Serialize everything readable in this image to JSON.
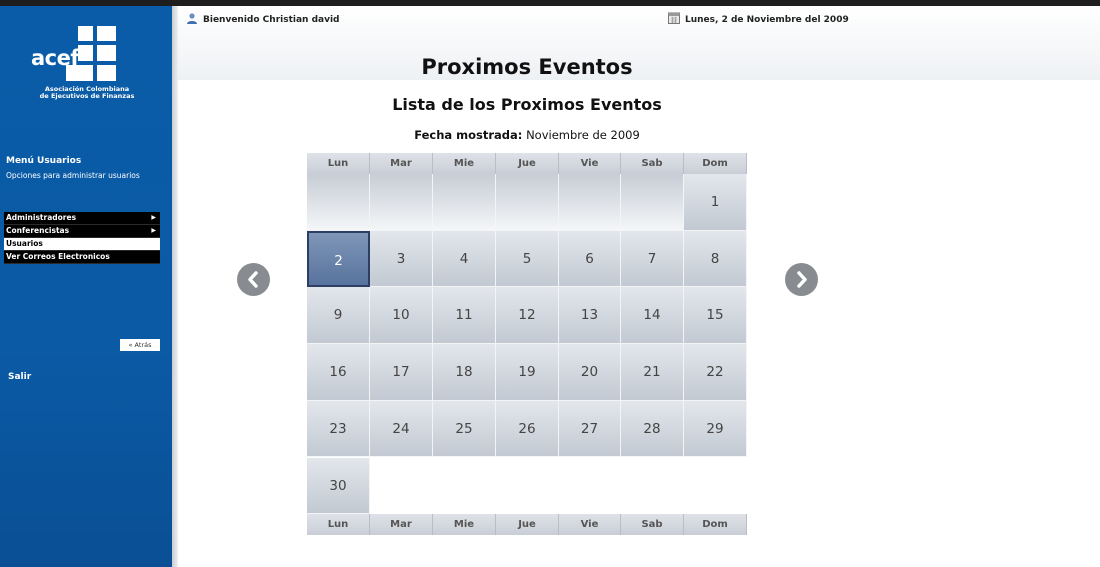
{
  "brand": {
    "logo_text": "acef",
    "subtitle_line1": "Asociación Colombiana",
    "subtitle_line2": "de Ejecutivos de Finanzas"
  },
  "header": {
    "welcome": "Bienvenido Christian david",
    "date": "Lunes, 2 de Noviembre del 2009",
    "user_icon": "user-icon",
    "calendar_icon": "calendar-icon"
  },
  "sidebar": {
    "menu_title": "Menú Usuarios",
    "menu_desc": "Opciones para administrar usuarios",
    "items": [
      {
        "label": "Administradores",
        "has_submenu": true,
        "active": false
      },
      {
        "label": "Conferencistas",
        "has_submenu": true,
        "active": false
      },
      {
        "label": "Usuarios",
        "has_submenu": false,
        "active": true
      },
      {
        "label": "Ver Correos Electronicos",
        "has_submenu": false,
        "active": false
      }
    ],
    "back_label": "« Atrás",
    "logout_label": "Salir"
  },
  "main": {
    "title": "Proximos Eventos",
    "subtitle": "Lista de los Proximos Eventos",
    "fecha_label": "Fecha mostrada:",
    "fecha_value": "Noviembre de 2009"
  },
  "calendar": {
    "weekdays": [
      "Lun",
      "Mar",
      "Mie",
      "Jue",
      "Vie",
      "Sab",
      "Dom"
    ],
    "first_weekday_index": 6,
    "days_in_month": 30,
    "selected_day": 2,
    "prev_icon": "chevron-left-icon",
    "next_icon": "chevron-right-icon",
    "colors": {
      "selected": "#58739d",
      "cell": "#c2c9d2"
    }
  }
}
